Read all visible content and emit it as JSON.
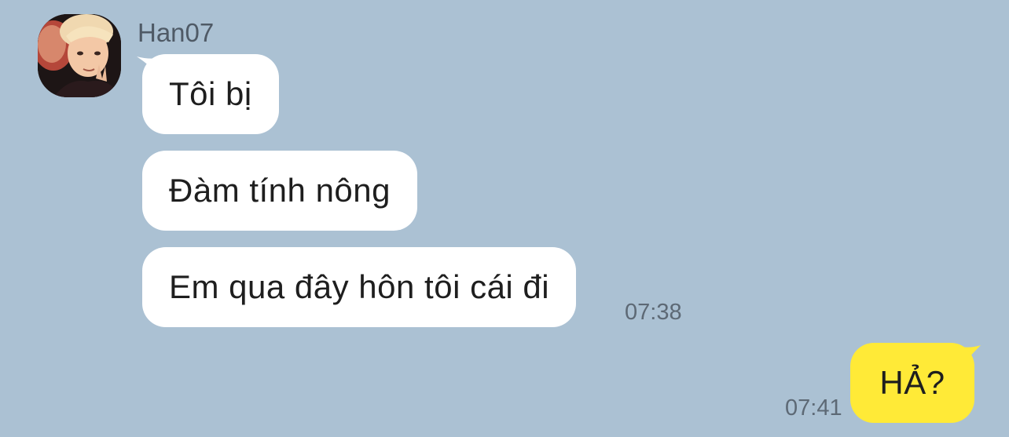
{
  "conversation": {
    "contact": {
      "name": "Han07",
      "avatar_icon": "profile-photo"
    },
    "incoming": [
      {
        "text": "Tôi bị"
      },
      {
        "text": "Đàm tính nông"
      },
      {
        "text": "Em qua đây hôn tôi cái đi"
      }
    ],
    "incoming_time": "07:38",
    "outgoing": [
      {
        "text": "HẢ?"
      }
    ],
    "outgoing_time": "07:41"
  },
  "colors": {
    "background": "#abc1d3",
    "incoming_bubble": "#ffffff",
    "outgoing_bubble": "#ffea37",
    "name_text": "#4f5a66",
    "time_text": "#5d6975"
  }
}
